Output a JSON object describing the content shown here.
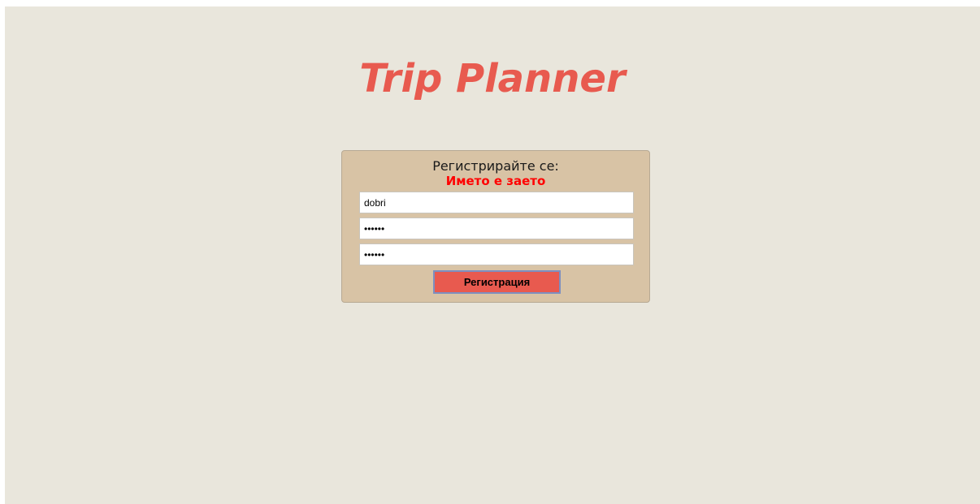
{
  "app": {
    "title": "Trip Planner"
  },
  "register_form": {
    "heading": "Регистрирайте се:",
    "error": "Името е заето",
    "username": {
      "value": "dobri"
    },
    "password": {
      "value": "123456"
    },
    "confirm_password": {
      "value": "123456"
    },
    "submit_label": "Регистрация"
  },
  "colors": {
    "page_background": "#e9e6dc",
    "panel_background": "#d8c3a5",
    "accent": "#e85a4f",
    "error": "#ff0000"
  }
}
